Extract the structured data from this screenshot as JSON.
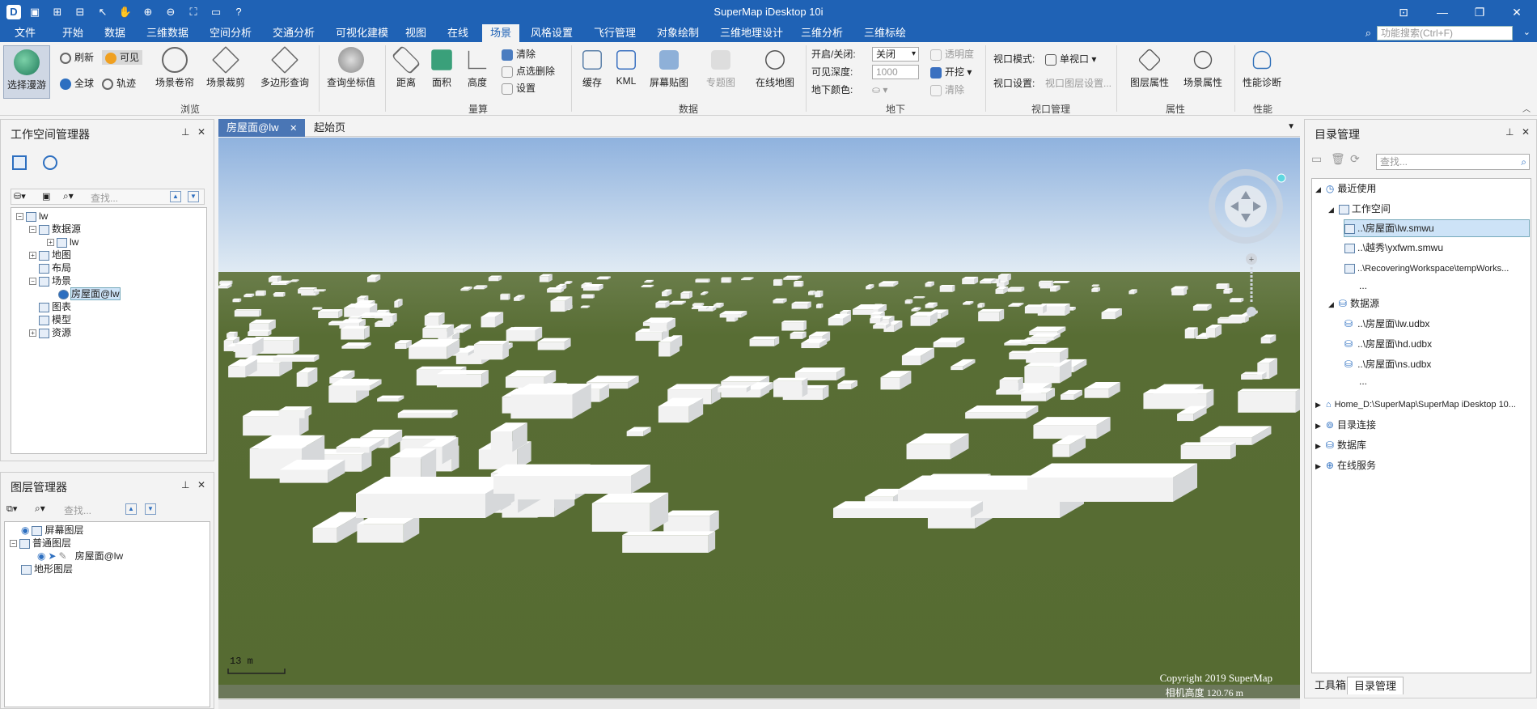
{
  "app": {
    "title": "SuperMap iDesktop 10i"
  },
  "menu": {
    "items": [
      "文件",
      "开始",
      "数据",
      "三维数据",
      "空间分析",
      "交通分析",
      "可视化建模",
      "视图",
      "在线",
      "场景",
      "风格设置",
      "飞行管理",
      "对象绘制",
      "三维地理设计",
      "三维分析",
      "三维标绘"
    ],
    "active": "场景",
    "search_placeholder": "功能搜索(Ctrl+F)"
  },
  "ribbon": {
    "browse": {
      "label": "浏览",
      "select_roam": "选择漫游",
      "refresh": "刷新",
      "visible": "可见",
      "full_globe": "全球",
      "track": "轨迹",
      "scene_roller": "场景卷帘",
      "scene_clip": "场景裁剪",
      "polygon_query": "多边形查询",
      "query_coord": "查询坐标值"
    },
    "measure": {
      "label": "量算",
      "distance": "距离",
      "area": "面积",
      "height": "高度",
      "clear": "清除",
      "point_delete": "点选删除",
      "settings": "设置"
    },
    "data": {
      "label": "数据",
      "cache": "缓存",
      "kml": "KML",
      "screen_map": "屏幕贴图",
      "thematic": "专题图",
      "online_map": "在线地图"
    },
    "underground": {
      "label": "地下",
      "on_off_label": "开启/关闭:",
      "on_off_value": "关闭",
      "depth_label": "可见深度:",
      "depth_value": "1000",
      "color_label": "地下颜色:",
      "transparency": "透明度",
      "excavate": "开挖",
      "clear": "清除"
    },
    "viewport": {
      "label": "视口管理",
      "mode_label": "视口模式:",
      "mode_value": "单视口",
      "settings_label": "视口设置:",
      "settings_value": "视口图层设置..."
    },
    "properties": {
      "label": "属性",
      "layer_props": "图层属性",
      "scene_props": "场景属性"
    },
    "performance": {
      "label": "性能",
      "diagnose": "性能诊断"
    }
  },
  "workspace_panel": {
    "title": "工作空间管理器",
    "search_placeholder": "查找...",
    "tree": [
      {
        "label": "lw",
        "level": 0
      },
      {
        "label": "数据源",
        "level": 1
      },
      {
        "label": "lw",
        "level": 2
      },
      {
        "label": "地图",
        "level": 1
      },
      {
        "label": "布局",
        "level": 1
      },
      {
        "label": "场景",
        "level": 1
      },
      {
        "label": "房屋面@lw",
        "level": 2
      },
      {
        "label": "图表",
        "level": 1
      },
      {
        "label": "模型",
        "level": 1
      },
      {
        "label": "资源",
        "level": 1
      }
    ]
  },
  "layer_panel": {
    "title": "图层管理器",
    "search_placeholder": "查找...",
    "tree": [
      {
        "label": "屏幕图层"
      },
      {
        "label": "普通图层"
      },
      {
        "label": "房屋面@lw"
      },
      {
        "label": "地形图层"
      }
    ]
  },
  "doc_tabs": {
    "active": "房屋面@lw",
    "other": "起始页"
  },
  "scene": {
    "scale_label": "13 m",
    "copyright": "Copyright 2019 SuperMap",
    "altitude": "相机高度 120.76 m"
  },
  "catalog_panel": {
    "title": "目录管理",
    "search_placeholder": "查找...",
    "recent": "最近使用",
    "workspace": "工作空间",
    "workspaces": [
      "..\\房屋面\\lw.smwu",
      "..\\越秀\\yxfwm.smwu",
      "..\\RecoveringWorkspace\\tempWorks..."
    ],
    "datasource": "数据源",
    "datasources": [
      "..\\房屋面\\lw.udbx",
      "..\\房屋面\\hd.udbx",
      "..\\房屋面\\ns.udbx"
    ],
    "ellipsis": "...",
    "home": "Home_D:\\SuperMap\\SuperMap iDesktop 10...",
    "dir_conn": "目录连接",
    "database": "数据库",
    "online_service": "在线服务",
    "tab_toolbox": "工具箱",
    "tab_catalog": "目录管理"
  },
  "colors": {
    "titlebar": "#1f62b5",
    "ground": "#566b32",
    "sky_top": "#8fb2de",
    "sky_bottom": "#e2ecf4",
    "building": "#f2f2f2"
  }
}
